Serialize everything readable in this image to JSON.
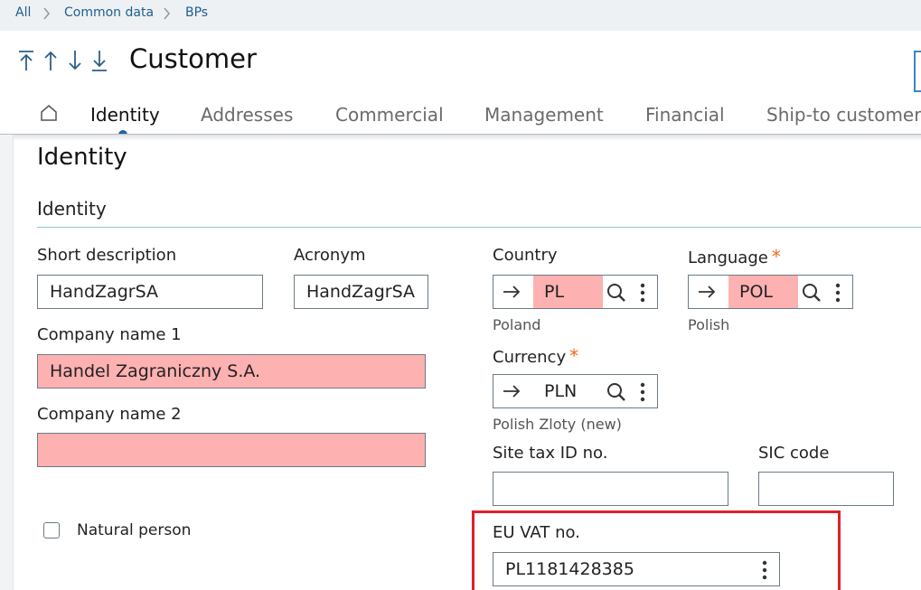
{
  "breadcrumb": {
    "items": [
      "All",
      "Common data",
      "BPs"
    ]
  },
  "header": {
    "title": "Customer"
  },
  "tabs": [
    {
      "label": "Identity",
      "active": true
    },
    {
      "label": "Addresses",
      "active": false
    },
    {
      "label": "Commercial",
      "active": false
    },
    {
      "label": "Management",
      "active": false
    },
    {
      "label": "Financial",
      "active": false
    },
    {
      "label": "Ship-to customer",
      "active": false
    }
  ],
  "section": {
    "title": "Identity"
  },
  "block": {
    "title": "Identity"
  },
  "fields": {
    "short_description": {
      "label": "Short description",
      "value": "HandZagrSA"
    },
    "acronym": {
      "label": "Acronym",
      "value": "HandZagrSA"
    },
    "company_name_1": {
      "label": "Company name 1",
      "value": "Handel Zagraniczny S.A."
    },
    "company_name_2": {
      "label": "Company name 2",
      "value": ""
    },
    "country": {
      "label": "Country",
      "value": "PL",
      "description": "Poland"
    },
    "language": {
      "label": "Language",
      "required_mark": "*",
      "value": "POL",
      "description": "Polish"
    },
    "currency": {
      "label": "Currency",
      "required_mark": "*",
      "value": "PLN",
      "description": "Polish Zloty (new)"
    },
    "site_tax_id": {
      "label": "Site tax ID no.",
      "value": ""
    },
    "sic_code": {
      "label": "SIC code",
      "value": ""
    },
    "natural_person": {
      "label": "Natural person",
      "checked": false
    },
    "eu_vat": {
      "label": "EU VAT no.",
      "value": "PL1181428385"
    }
  },
  "colors": {
    "accent": "#1e63a8",
    "error_fill": "#feb1b1",
    "required": "#ee6a1a",
    "highlight": "#e0202a"
  }
}
